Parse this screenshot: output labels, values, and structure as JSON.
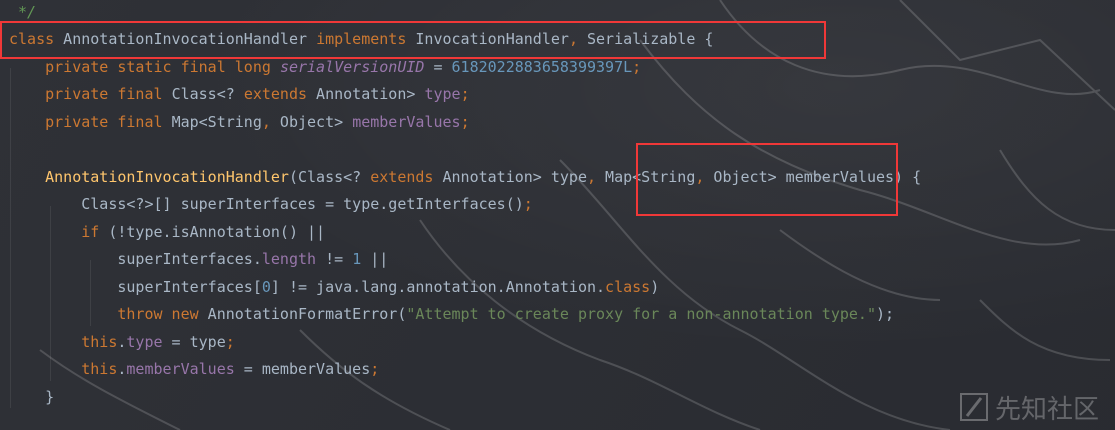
{
  "editor": {
    "language": "java",
    "highlight_color": "#f03838",
    "lines": [
      {
        "tokens": [
          {
            "t": "*/",
            "c": "cmt"
          }
        ]
      },
      {
        "tokens": [
          {
            "t": "class",
            "c": "kw"
          },
          {
            "t": " AnnotationInvocationHandler ",
            "c": ""
          },
          {
            "t": "implements",
            "c": "kw"
          },
          {
            "t": " InvocationHandler",
            "c": ""
          },
          {
            "t": ",",
            "c": "kw"
          },
          {
            "t": " Serializable {",
            "c": ""
          }
        ]
      },
      {
        "tokens": [
          {
            "t": "    private static final long ",
            "c": "kw"
          },
          {
            "t": "serialVersionUID",
            "c": "fldi"
          },
          {
            "t": " = ",
            "c": ""
          },
          {
            "t": "6182022883658399397L",
            "c": "num"
          },
          {
            "t": ";",
            "c": "kw"
          }
        ]
      },
      {
        "tokens": [
          {
            "t": "    private final ",
            "c": "kw"
          },
          {
            "t": "Class<? ",
            "c": ""
          },
          {
            "t": "extends",
            "c": "kw"
          },
          {
            "t": " Annotation> ",
            "c": ""
          },
          {
            "t": "type",
            "c": "fld"
          },
          {
            "t": ";",
            "c": "kw"
          }
        ]
      },
      {
        "tokens": [
          {
            "t": "    private final ",
            "c": "kw"
          },
          {
            "t": "Map<String",
            "c": ""
          },
          {
            "t": ",",
            "c": "kw"
          },
          {
            "t": " Object> ",
            "c": ""
          },
          {
            "t": "memberValues",
            "c": "fld"
          },
          {
            "t": ";",
            "c": "kw"
          }
        ]
      },
      {
        "tokens": [
          {
            "t": "",
            "c": ""
          }
        ]
      },
      {
        "tokens": [
          {
            "t": "    AnnotationInvocationHandler",
            "c": "fn"
          },
          {
            "t": "(Class<? ",
            "c": ""
          },
          {
            "t": "extends",
            "c": "kw"
          },
          {
            "t": " Annotation> type",
            "c": ""
          },
          {
            "t": ",",
            "c": "kw"
          },
          {
            "t": " Map<String",
            "c": ""
          },
          {
            "t": ",",
            "c": "kw"
          },
          {
            "t": " Object> memberValues) {",
            "c": ""
          }
        ]
      },
      {
        "tokens": [
          {
            "t": "        Class<?>[] superInterfaces = type.getInterfaces()",
            "c": ""
          },
          {
            "t": ";",
            "c": "kw"
          }
        ]
      },
      {
        "tokens": [
          {
            "t": "        if",
            "c": "kw"
          },
          {
            "t": " (!type.isAnnotation() ||",
            "c": ""
          }
        ]
      },
      {
        "tokens": [
          {
            "t": "            superInterfaces.",
            "c": ""
          },
          {
            "t": "length",
            "c": "fld"
          },
          {
            "t": " != ",
            "c": ""
          },
          {
            "t": "1",
            "c": "num"
          },
          {
            "t": " ||",
            "c": ""
          }
        ]
      },
      {
        "tokens": [
          {
            "t": "            superInterfaces[",
            "c": ""
          },
          {
            "t": "0",
            "c": "num"
          },
          {
            "t": "] != java.lang.annotation.Annotation.",
            "c": ""
          },
          {
            "t": "class",
            "c": "kw"
          },
          {
            "t": ")",
            "c": ""
          }
        ]
      },
      {
        "tokens": [
          {
            "t": "            throw new",
            "c": "kw"
          },
          {
            "t": " AnnotationFormatError(",
            "c": ""
          },
          {
            "t": "\"Attempt to create proxy for a non-annotation type.\"",
            "c": "str"
          },
          {
            "t": ");",
            "c": ""
          }
        ]
      },
      {
        "tokens": [
          {
            "t": "        this",
            "c": "kw"
          },
          {
            "t": ".",
            "c": ""
          },
          {
            "t": "type",
            "c": "fld"
          },
          {
            "t": " = type",
            "c": ""
          },
          {
            "t": ";",
            "c": "kw"
          }
        ]
      },
      {
        "tokens": [
          {
            "t": "        this",
            "c": "kw"
          },
          {
            "t": ".",
            "c": ""
          },
          {
            "t": "memberValues",
            "c": "fld"
          },
          {
            "t": " = memberValues",
            "c": ""
          },
          {
            "t": ";",
            "c": "kw"
          }
        ]
      },
      {
        "tokens": [
          {
            "t": "    }",
            "c": ""
          }
        ]
      }
    ]
  },
  "watermark": {
    "text": "先知社区",
    "icon": "xianzhi-logo-icon"
  }
}
